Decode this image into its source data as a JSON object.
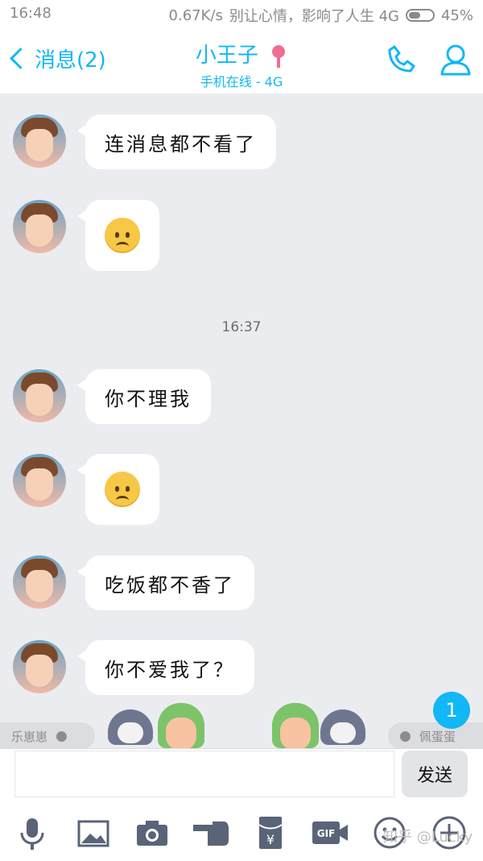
{
  "status_bar": {
    "time": "16:48",
    "network_speed": "0.67K/s",
    "carrier": "别让心情，影响了人生 4G",
    "battery": "45%"
  },
  "header": {
    "back_label": "消息(2)",
    "title": "小王子",
    "subtitle": "手机在线 - 4G"
  },
  "messages": [
    {
      "text": "连消息都不看了"
    },
    {
      "text": "",
      "emoji": "sad-emoji"
    },
    {
      "text": "你不理我"
    },
    {
      "text": "",
      "emoji": "sad-emoji"
    },
    {
      "text": "吃饭都不香了"
    },
    {
      "text": "你不爱我了？"
    }
  ],
  "timestamp": "16:37",
  "couple": {
    "left_name": "乐崽崽",
    "right_name": "佩蛋蛋",
    "notification_count": "1"
  },
  "input": {
    "placeholder": "",
    "send_label": "发送"
  },
  "toolbar_icons": [
    "microphone-icon",
    "image-icon",
    "camera-icon",
    "poke-icon",
    "red-packet-icon",
    "gif-icon",
    "emoji-icon",
    "plus-icon"
  ],
  "watermark": "知乎 @Lucky",
  "colors": {
    "accent": "#12b7f5",
    "background": "#ebecf0"
  }
}
